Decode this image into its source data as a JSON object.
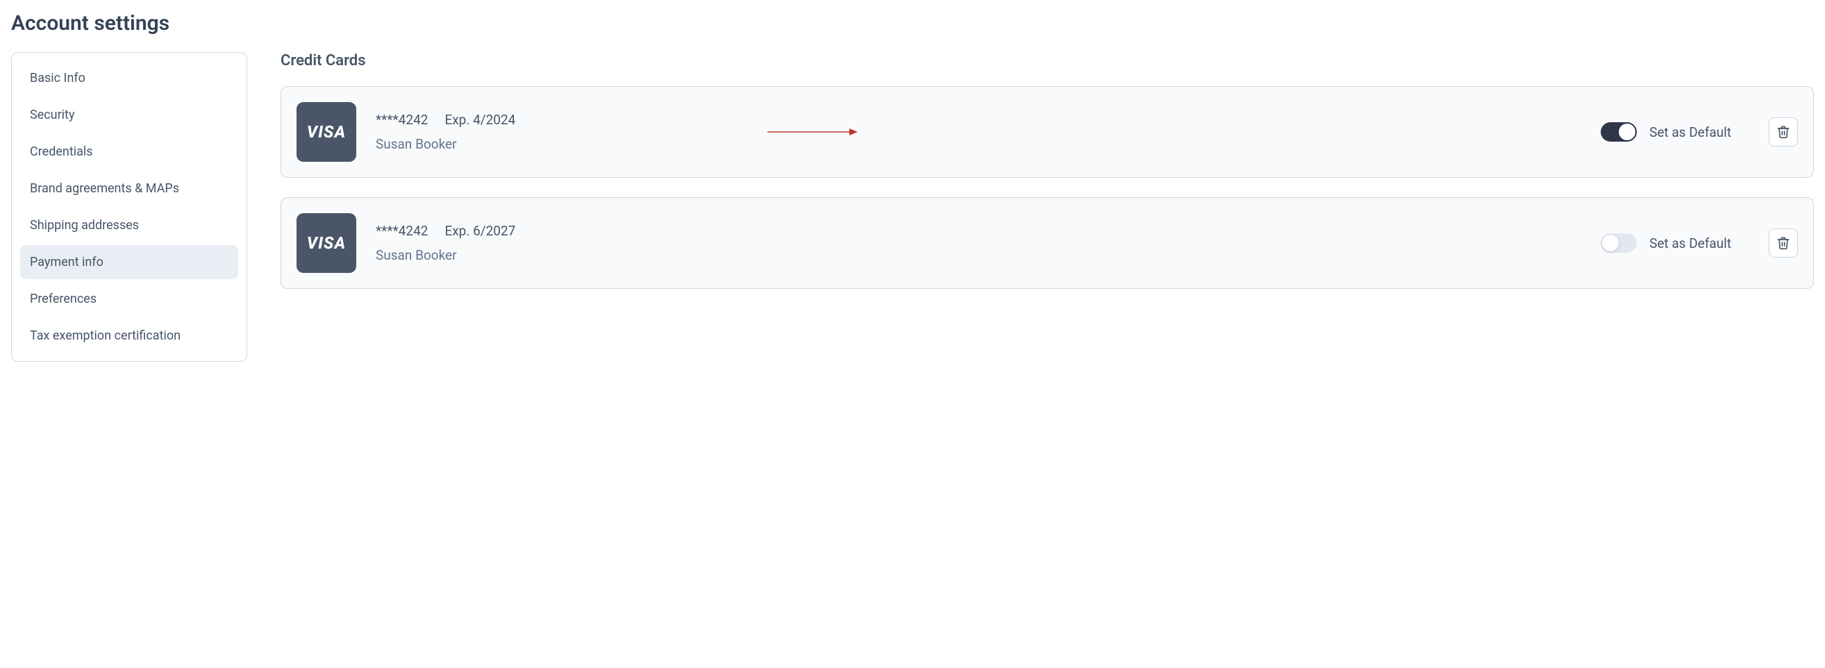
{
  "page": {
    "title": "Account settings"
  },
  "sidebar": {
    "items": [
      {
        "label": "Basic Info",
        "active": false
      },
      {
        "label": "Security",
        "active": false
      },
      {
        "label": "Credentials",
        "active": false
      },
      {
        "label": "Brand agreements & MAPs",
        "active": false
      },
      {
        "label": "Shipping addresses",
        "active": false
      },
      {
        "label": "Payment info",
        "active": true
      },
      {
        "label": "Preferences",
        "active": false
      },
      {
        "label": "Tax exemption certification",
        "active": false
      }
    ]
  },
  "main": {
    "section_title": "Credit Cards",
    "cards": [
      {
        "brand": "VISA",
        "masked": "****4242",
        "expiry": "Exp. 4/2024",
        "name": "Susan Booker",
        "default": true,
        "default_label": "Set as Default",
        "annotated": true
      },
      {
        "brand": "VISA",
        "masked": "****4242",
        "expiry": "Exp. 6/2027",
        "name": "Susan Booker",
        "default": false,
        "default_label": "Set as Default",
        "annotated": false
      }
    ]
  },
  "colors": {
    "accent_dark": "#2d3748",
    "border": "#cbd5e1",
    "bg_card": "#f8fafc",
    "text": "#475569",
    "annotation": "#c0392b"
  }
}
